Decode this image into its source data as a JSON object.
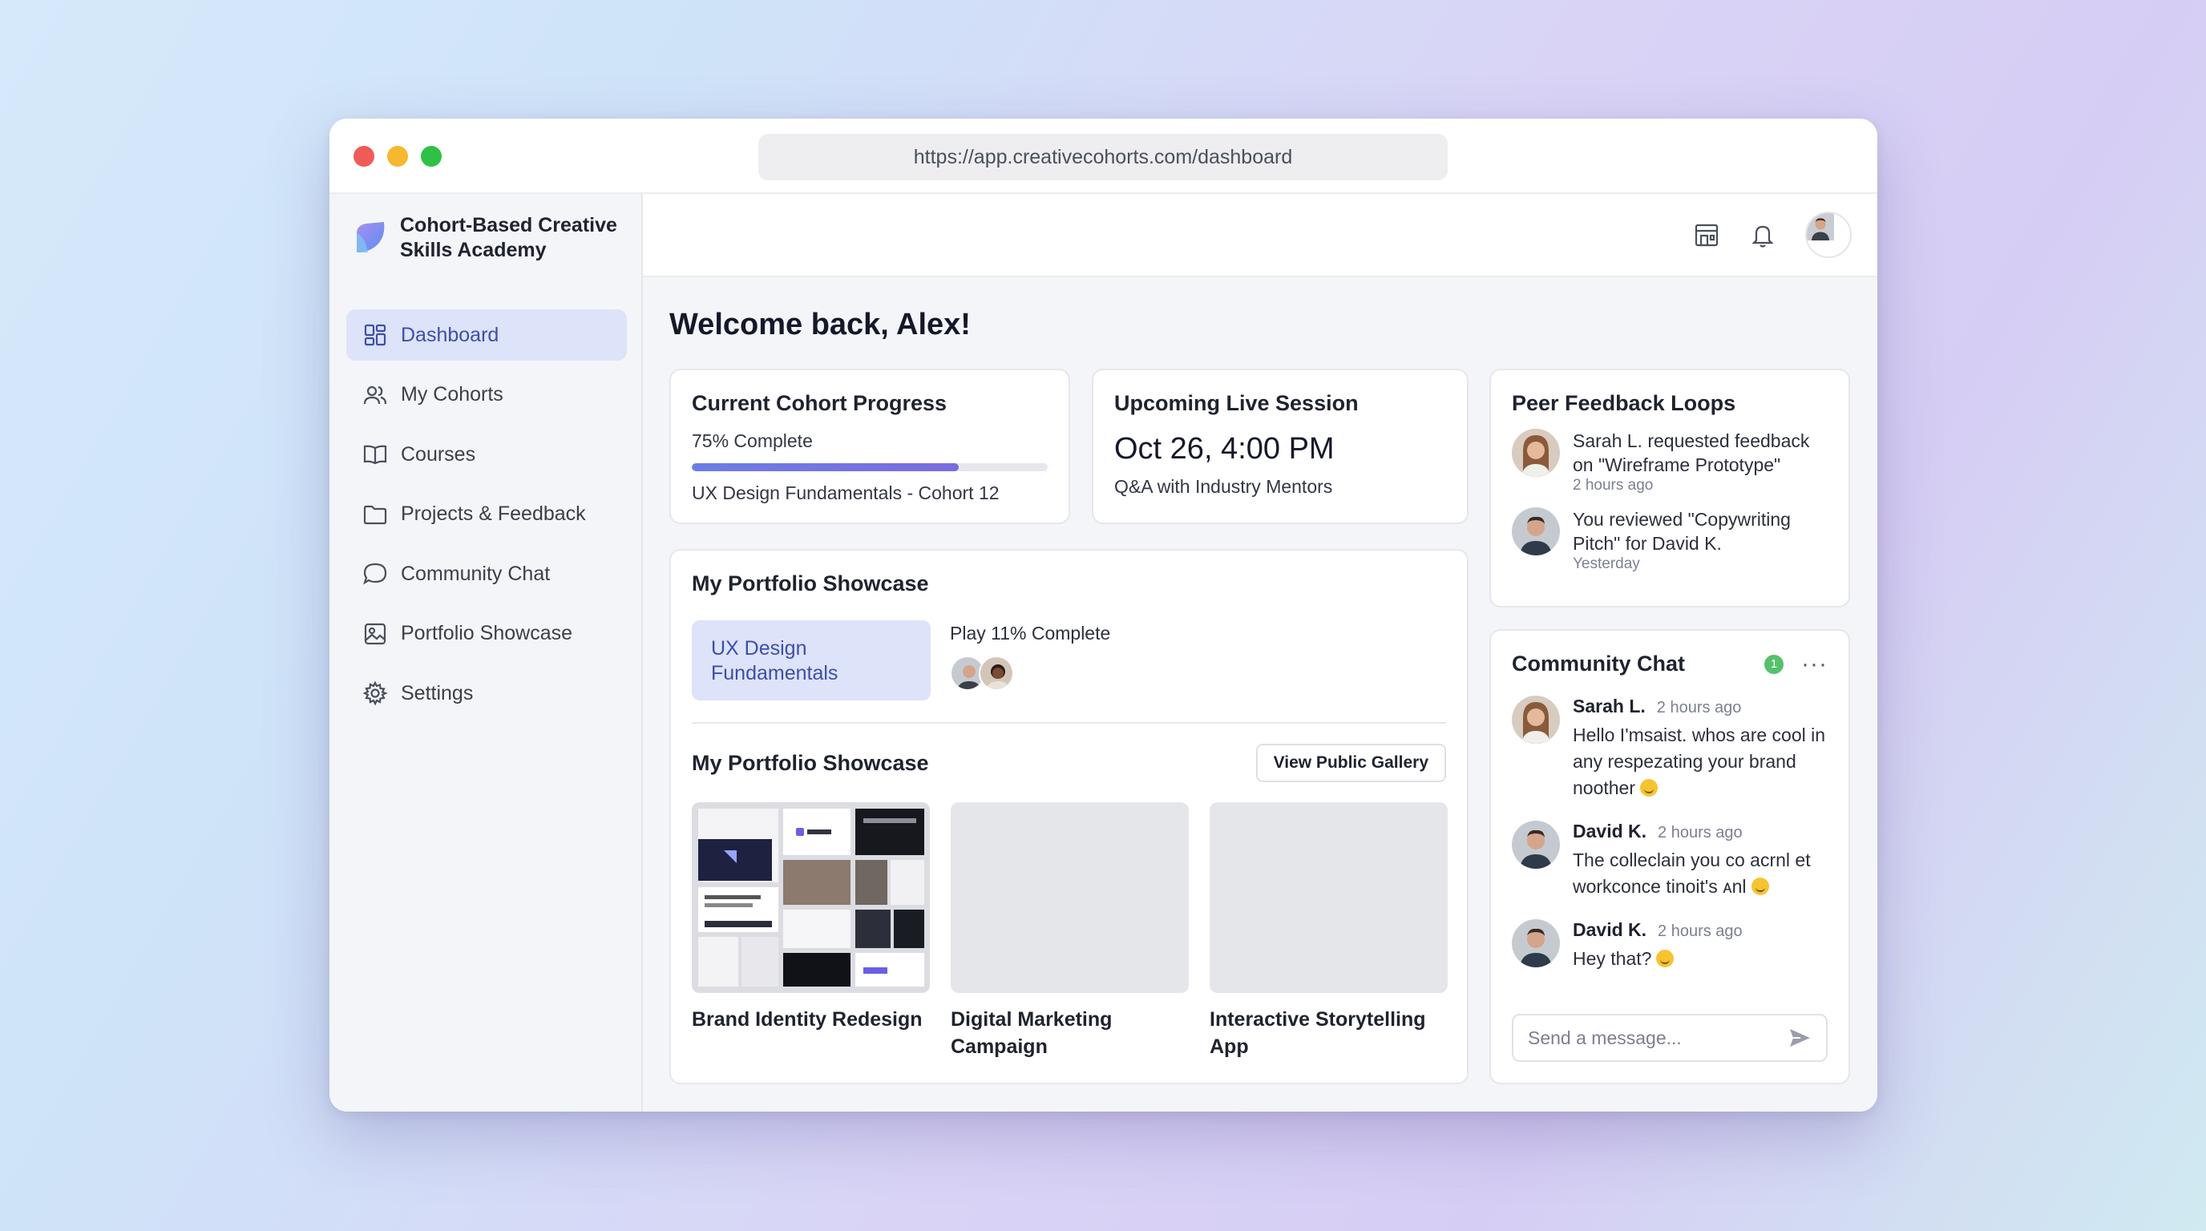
{
  "browser": {
    "url": "https://app.creativecohorts.com/dashboard"
  },
  "brand": {
    "name": "Cohort-Based Creative Skills Academy"
  },
  "sidebar": {
    "items": [
      {
        "label": "Dashboard",
        "icon": "dashboard-icon",
        "active": true
      },
      {
        "label": "My Cohorts",
        "icon": "users-icon"
      },
      {
        "label": "Courses",
        "icon": "book-icon"
      },
      {
        "label": "Projects & Feedback",
        "icon": "folder-icon"
      },
      {
        "label": "Community Chat",
        "icon": "chat-bubble-icon"
      },
      {
        "label": "Portfolio Showcase",
        "icon": "image-icon"
      },
      {
        "label": "Settings",
        "icon": "gear-icon"
      }
    ]
  },
  "topbar": {
    "icons": [
      "store-icon",
      "bell-icon",
      "avatar"
    ]
  },
  "welcome": "Welcome back, Alex!",
  "progress_card": {
    "title": "Current Cohort Progress",
    "percent_label": "75% Complete",
    "percent": 0.75,
    "cohort": "UX Design Fundamentals - Cohort 12"
  },
  "session_card": {
    "title": "Upcoming Live Session",
    "date": "Oct 26, 4:00 PM",
    "description": "Q&A with Industry Mentors"
  },
  "peer_card": {
    "title": "Peer Feedback Loops",
    "items": [
      {
        "text": "Sarah L. requested feedback on \"Wireframe Prototype\"",
        "time": "2 hours ago"
      },
      {
        "text": "You reviewed \"Copywriting Pitch\" for David K.",
        "time": "Yesterday"
      }
    ]
  },
  "portfolio_card": {
    "title": "My Portfolio Showcase",
    "chip": "UX Design Fundamentals",
    "play_label": "Play 11% Complete",
    "title2": "My Portfolio Showcase",
    "gallery_button": "View Public Gallery",
    "projects": [
      {
        "label": "Brand Identity Redesign"
      },
      {
        "label": "Digital Marketing Campaign"
      },
      {
        "label": "Interactive Storytelling App"
      }
    ]
  },
  "chat_card": {
    "title": "Community Chat",
    "badge": "1",
    "more": "···",
    "messages": [
      {
        "name": "Sarah L.",
        "time": "2 hours ago",
        "text": "Hello I'msaist. whos are cool in any respezating your brand noother"
      },
      {
        "name": "David K.",
        "time": "2 hours ago",
        "text": "The colleclain you co acrnl et workconce tinoit's ᴀnl"
      },
      {
        "name": "David K.",
        "time": "2 hours ago",
        "text": "Hey that?"
      }
    ],
    "input_placeholder": "Send a message..."
  },
  "colors": {
    "accent": "#3d4fa8",
    "accent_bg": "#dde3f9",
    "progress": "#6c7ee6",
    "badge": "#55c16a"
  }
}
